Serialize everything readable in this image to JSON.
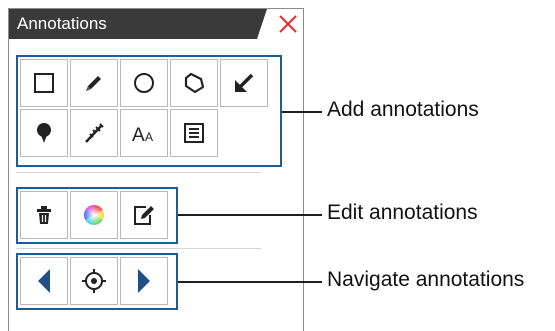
{
  "panel": {
    "title": "Annotations",
    "colors": {
      "tab": "#3a3a3a",
      "close": "#e0302b",
      "border": "#1f5a99"
    }
  },
  "groups": {
    "add": {
      "callout": "Add annotations",
      "buttons": [
        "rectangle-icon",
        "pencil-icon",
        "circle-icon",
        "polygon-icon",
        "arrow-icon",
        "pin-icon",
        "ruler-icon",
        "text-icon",
        "note-icon"
      ],
      "text_tool_glyph": "AA"
    },
    "edit": {
      "callout": "Edit annotations",
      "buttons": [
        "trash-icon",
        "color-wheel-icon",
        "edit-note-icon"
      ]
    },
    "navigate": {
      "callout": "Navigate annotations",
      "buttons": [
        "previous-icon",
        "locate-icon",
        "next-icon"
      ]
    }
  }
}
